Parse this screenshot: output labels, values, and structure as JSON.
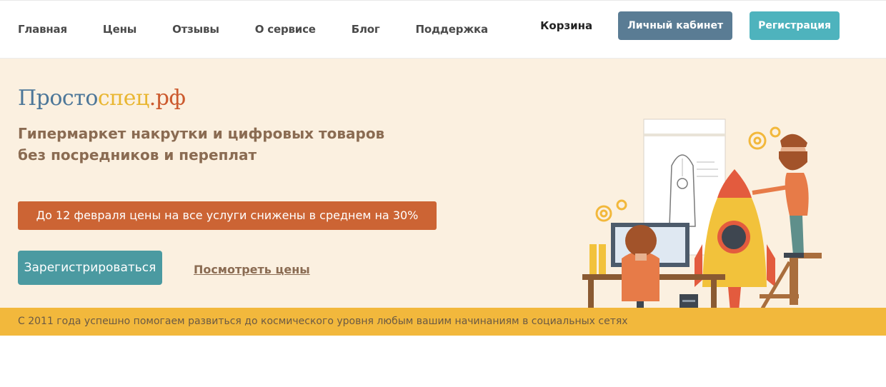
{
  "nav": {
    "links": [
      {
        "label": "Главная"
      },
      {
        "label": "Цены"
      },
      {
        "label": "Отзывы"
      },
      {
        "label": "О сервисе"
      },
      {
        "label": "Блог"
      },
      {
        "label": "Поддержка"
      }
    ],
    "cart_label": "Корзина",
    "cabinet_label": "Личный кабинет",
    "register_label": "Регистрация"
  },
  "hero": {
    "logo": {
      "part1": "Просто",
      "part2": "спец",
      "part3": ".рф"
    },
    "tagline_line1": "Гипермаркет накрутки и цифровых товаров",
    "tagline_line2": "без посредников и переплат",
    "promo": "До 12 февраля цены на все услуги снижены в среднем на 30%",
    "signup_label": "Зарегистрироваться",
    "prices_link": "Посмотреть цены",
    "bottom_text": "С 2011 года успешно помогаем развиться до космического уровня любым вашим начинаниям в социальных сетях"
  },
  "colors": {
    "hero_bg": "#fbf0e0",
    "promo_bg": "#cc6434",
    "signup_bg": "#4b9aa1",
    "cabinet_bg": "#5a7c94",
    "register_bg": "#4eb3bd",
    "bottom_bar": "#f2b83c"
  },
  "icons": [
    "gear-icon",
    "rocket-illustration",
    "desk-scene-illustration"
  ]
}
